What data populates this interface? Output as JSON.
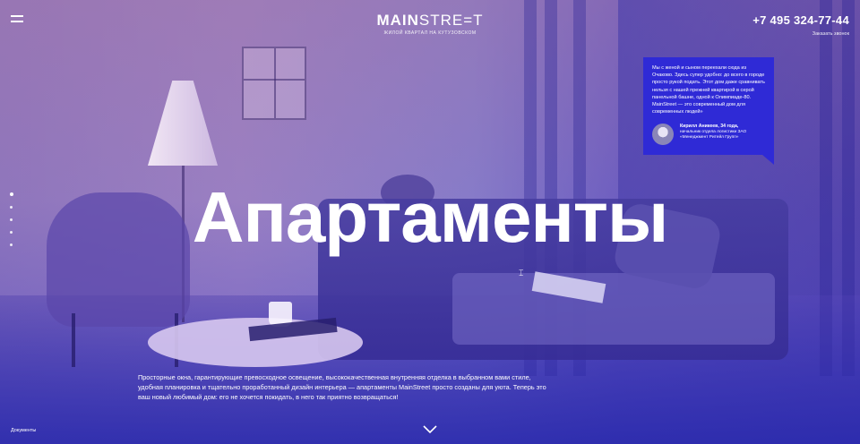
{
  "header": {
    "logo_main": "MAIN",
    "logo_secondary": "STRE=T",
    "logo_subtitle": "ЖИЛОЙ КВАРТАЛ НА КУТУЗОВСКОМ",
    "phone": "+7 495 324-77-44",
    "callback_label": "Заказать звонок"
  },
  "hero": {
    "title": "Апартаменты",
    "description": "Просторные окна, гарантирующие превосходное освещение, высококачественная внутренняя отделка в выбранном вами стиле, удобная планировка и тщательно проработанный дизайн интерьера — апартаменты MainStreet просто созданы для уюта. Теперь это ваш новый любимый дом: его не хочется покидать, в него так приятно возвращаться!"
  },
  "testimonial": {
    "text": "Мы с женой и сыном переехали сюда из Очаково. Здесь супер удобно: до всего в городе просто рукой подать. Этот дом даже сравнивать нельзя с нашей прежней квартирой в серой панельной башне, одной к Олимпиаде-80. MainStreet — это современный дом для современных людей»",
    "author_name": "Кирилл Аникеев, 34 года,",
    "author_role": "начальник отдела логистики ЗАО «Менеджмент Ритейл Групп»"
  },
  "navigation": {
    "slides_count": 5,
    "active_slide": 1
  },
  "footer": {
    "documents_link": "Документы"
  },
  "icons": {
    "menu": "hamburger-menu-icon",
    "scroll": "chevron-down-icon",
    "cursor": "text-cursor-icon"
  },
  "colors": {
    "overlay_blue": "#2f2ad6",
    "text": "#ffffff"
  }
}
